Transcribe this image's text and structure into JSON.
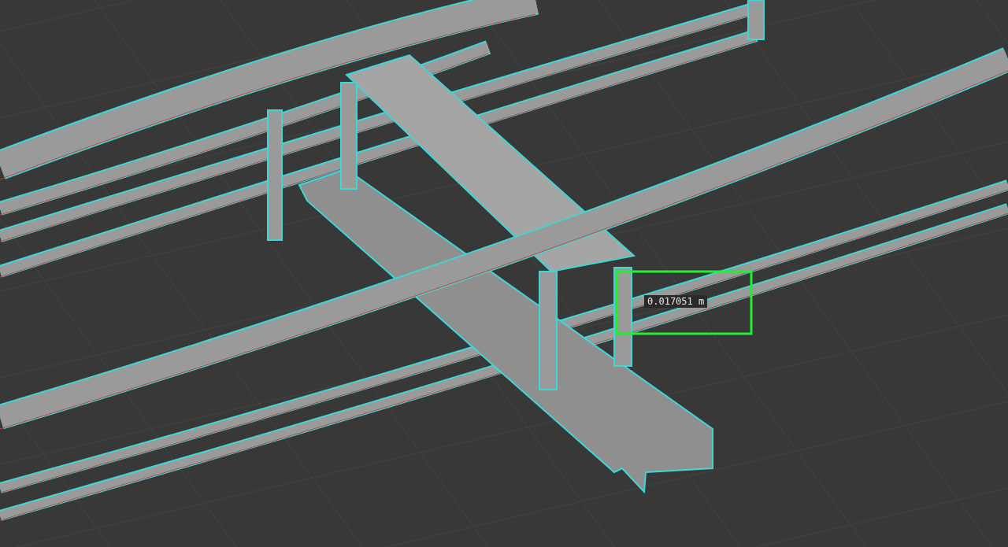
{
  "viewport": {
    "measurement": {
      "label": "0.017051 m"
    }
  }
}
